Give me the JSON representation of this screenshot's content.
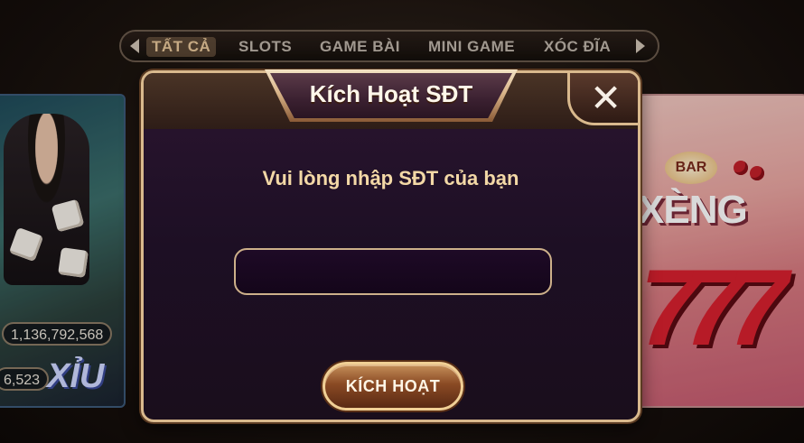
{
  "tabs": {
    "items": [
      {
        "label": "TẤT CẢ",
        "active": true
      },
      {
        "label": "SLOTS",
        "active": false
      },
      {
        "label": "GAME BÀI",
        "active": false
      },
      {
        "label": "MINI GAME",
        "active": false
      },
      {
        "label": "XÓC ĐĨA",
        "active": false
      }
    ],
    "prev_icon": "triangle-left-icon",
    "next_icon": "triangle-right-icon"
  },
  "cards": {
    "left": {
      "jackpot_1": "1,136,792,568",
      "jackpot_2": "6,523",
      "game_name": "XỈU"
    },
    "right": {
      "badge": "BAR",
      "game_name": "XÈNG",
      "sevens": "777"
    }
  },
  "dialog": {
    "title": "Kích Hoạt SĐT",
    "prompt": "Vui lòng nhập SĐT của bạn",
    "input_value": "",
    "button_label": "KÍCH HOẠT",
    "close_icon": "close-icon"
  },
  "colors": {
    "accent_gold": "#d9b98d",
    "dialog_bg": "#1d0f24",
    "prompt_text": "#f3d8a6"
  }
}
